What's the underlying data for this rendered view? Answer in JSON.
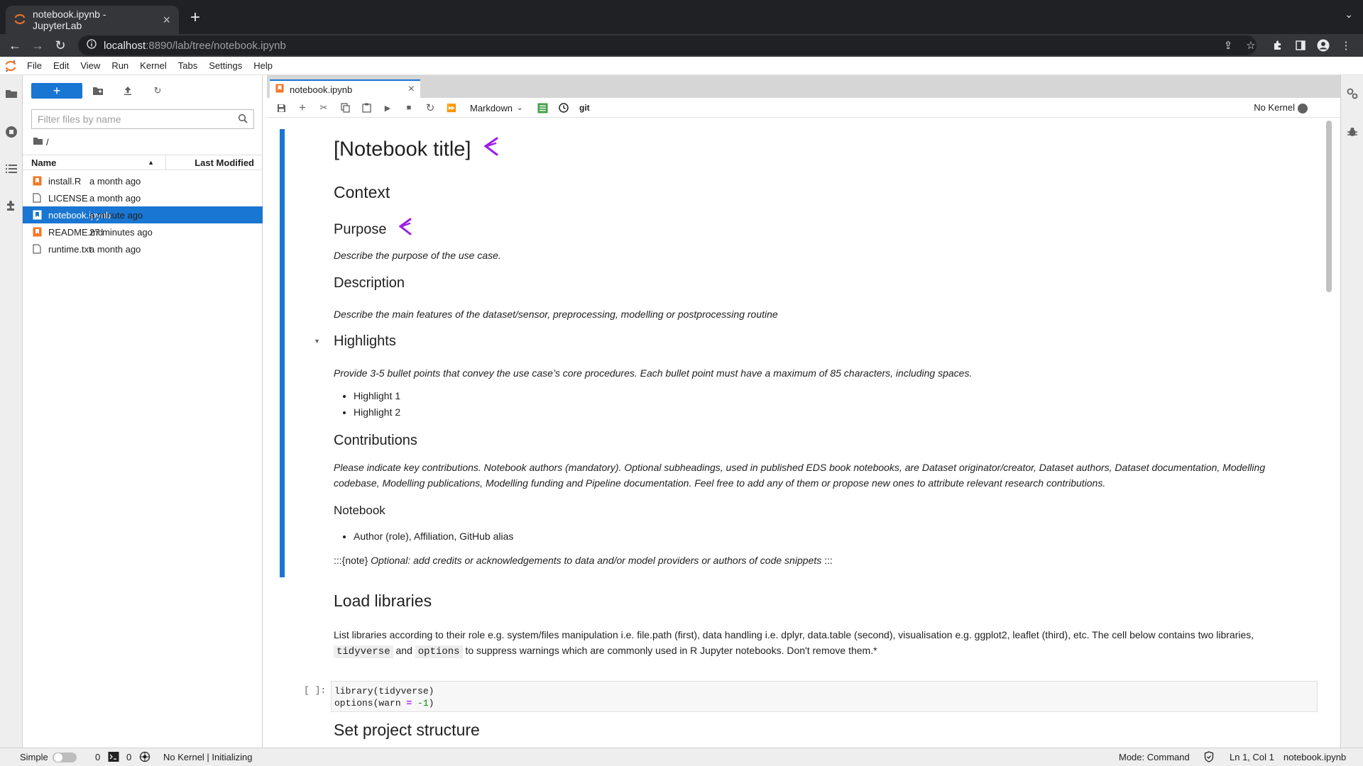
{
  "browser": {
    "tab_title": "notebook.ipynb - JupyterLab",
    "url_host": "localhost",
    "url_path": ":8890/lab/tree/notebook.ipynb"
  },
  "menubar": [
    "File",
    "Edit",
    "View",
    "Run",
    "Kernel",
    "Tabs",
    "Settings",
    "Help"
  ],
  "filebrowser": {
    "filter_placeholder": "Filter files by name",
    "breadcrumb": "/",
    "col_name": "Name",
    "col_modified": "Last Modified",
    "files": [
      {
        "name": "install.R",
        "modified": "a month ago",
        "type": "r"
      },
      {
        "name": "LICENSE",
        "modified": "a month ago",
        "type": "file"
      },
      {
        "name": "notebook.ipynb",
        "modified": "a minute ago",
        "type": "notebook",
        "selected": true
      },
      {
        "name": "README.md",
        "modified": "27 minutes ago",
        "type": "markdown"
      },
      {
        "name": "runtime.txt",
        "modified": "a month ago",
        "type": "file"
      }
    ]
  },
  "notebook": {
    "tab_label": "notebook.ipynb",
    "cell_type": "Markdown",
    "git_label": "git",
    "kernel": "No Kernel",
    "title": "[Notebook title]",
    "context": "Context",
    "purpose": "Purpose",
    "purpose_text": "Describe the purpose of the use case.",
    "description": "Description",
    "description_text": "Describe the main features of the dataset/sensor, preprocessing, modelling or postprocessing routine",
    "highlights": "Highlights",
    "highlights_text": "Provide 3-5 bullet points that convey the use case’s core procedures. Each bullet point must have a maximum of 85 characters, including spaces.",
    "highlight_items": [
      "Highlight 1",
      "Highlight 2"
    ],
    "contributions": "Contributions",
    "contributions_text": "Please indicate key contributions. Notebook authors (mandatory). Optional subheadings, used in published EDS book notebooks, are Dataset originator/creator, Dataset authors, Dataset documentation, Modelling codebase, Modelling publications, Modelling funding and Pipeline documentation. Feel free to add any of them or propose new ones to attribute relevant research contributions.",
    "notebook_sub": "Notebook",
    "author_item": "Author (role), Affiliation, GitHub alias",
    "note_prefix": ":::{note}",
    "note_text": "Optional: add credits or acknowledgements to data and/or model providers or authors of code snippets",
    "note_suffix": ":::",
    "load_libraries": "Load libraries",
    "libs_text_1": "List libraries according to their role e.g. system/files manipulation i.e. file.path (first), data handling i.e. dplyr, data.table (second), visualisation e.g. ggplot2, leaflet (third), etc. The cell below contains two libraries,",
    "libs_code_1": "tidyverse",
    "libs_and": "and",
    "libs_code_2": "options",
    "libs_text_2": "to suppress warnings which are commonly used in R Jupyter notebooks. Don't remove them.*",
    "prompt": "[ ]:",
    "code_line1": "library(tidyverse)",
    "code_line2_a": "options(warn ",
    "code_line2_op": "=",
    "code_line2_num": "-1",
    "code_line2_b": ")",
    "set_project": "Set project structure"
  },
  "statusbar": {
    "mode_label": "Simple",
    "terminals": "0",
    "kernels": "0",
    "kernel_status": "No Kernel | Initializing",
    "mode": "Mode: Command",
    "position": "Ln 1, Col 1",
    "filename": "notebook.ipynb"
  },
  "colors": {
    "accent": "#1976d2",
    "brand": "#f37726",
    "annotation": "#9b1de8"
  }
}
